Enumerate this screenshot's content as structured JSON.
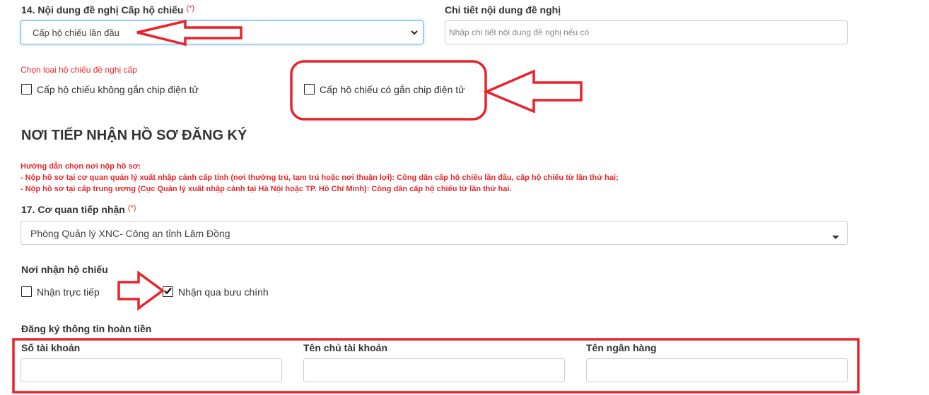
{
  "field14": {
    "label": "14. Nội dung đề nghị Cấp hộ chiếu",
    "required_mark": "(*)",
    "selected": "Cấp hộ chiếu lần đầu"
  },
  "detail": {
    "label": "Chi tiết nội dung đề nghị",
    "placeholder": "Nhập chi tiết nội dung đề nghị nếu có"
  },
  "passport_type": {
    "prompt": "Chọn loại hộ chiếu đề nghị cấp",
    "option_no_chip": "Cấp hộ chiếu không gắn chip điện tử",
    "option_chip": "Cấp hộ chiếu có gắn chip điện tử"
  },
  "section": {
    "title": "NƠI TIẾP NHẬN HỒ SƠ ĐĂNG KÝ"
  },
  "guide": {
    "heading": "Hướng dẫn chọn nơi nộp hồ sơ:",
    "line1": "- Nộp hồ sơ tại cơ quan quản lý xuất nhập cảnh cấp tỉnh (nơi thường trú, tạm trú hoặc nơi thuận lợi): Công dân cấp hộ chiếu lần đầu, cấp hộ chiếu từ lần thứ hai;",
    "line2": "- Nộp hồ sơ tại cấp trung ương (Cục Quản lý xuất nhập cảnh tại Hà Nội hoặc TP. Hồ Chí Minh): Công dân cấp hộ chiếu từ lần thứ hai."
  },
  "field17": {
    "label": "17. Cơ quan tiếp nhận",
    "required_mark": "(*)",
    "selected": "Phòng Quản lý XNC- Công an tỉnh Lâm Đồng"
  },
  "receive": {
    "label": "Nơi nhận hộ chiếu",
    "option_direct": "Nhận trực tiếp",
    "option_post": "Nhận qua bưu chính",
    "post_checked": true
  },
  "refund": {
    "label": "Đăng ký thông tin hoàn tiền",
    "account_number_label": "Số tài khoản",
    "account_owner_label": "Tên chủ tài khoản",
    "bank_name_label": "Tên ngân hàng"
  },
  "colors": {
    "annotation_red": "#e8232c",
    "required_red": "#e8282b",
    "focus_blue": "#66afe9"
  }
}
